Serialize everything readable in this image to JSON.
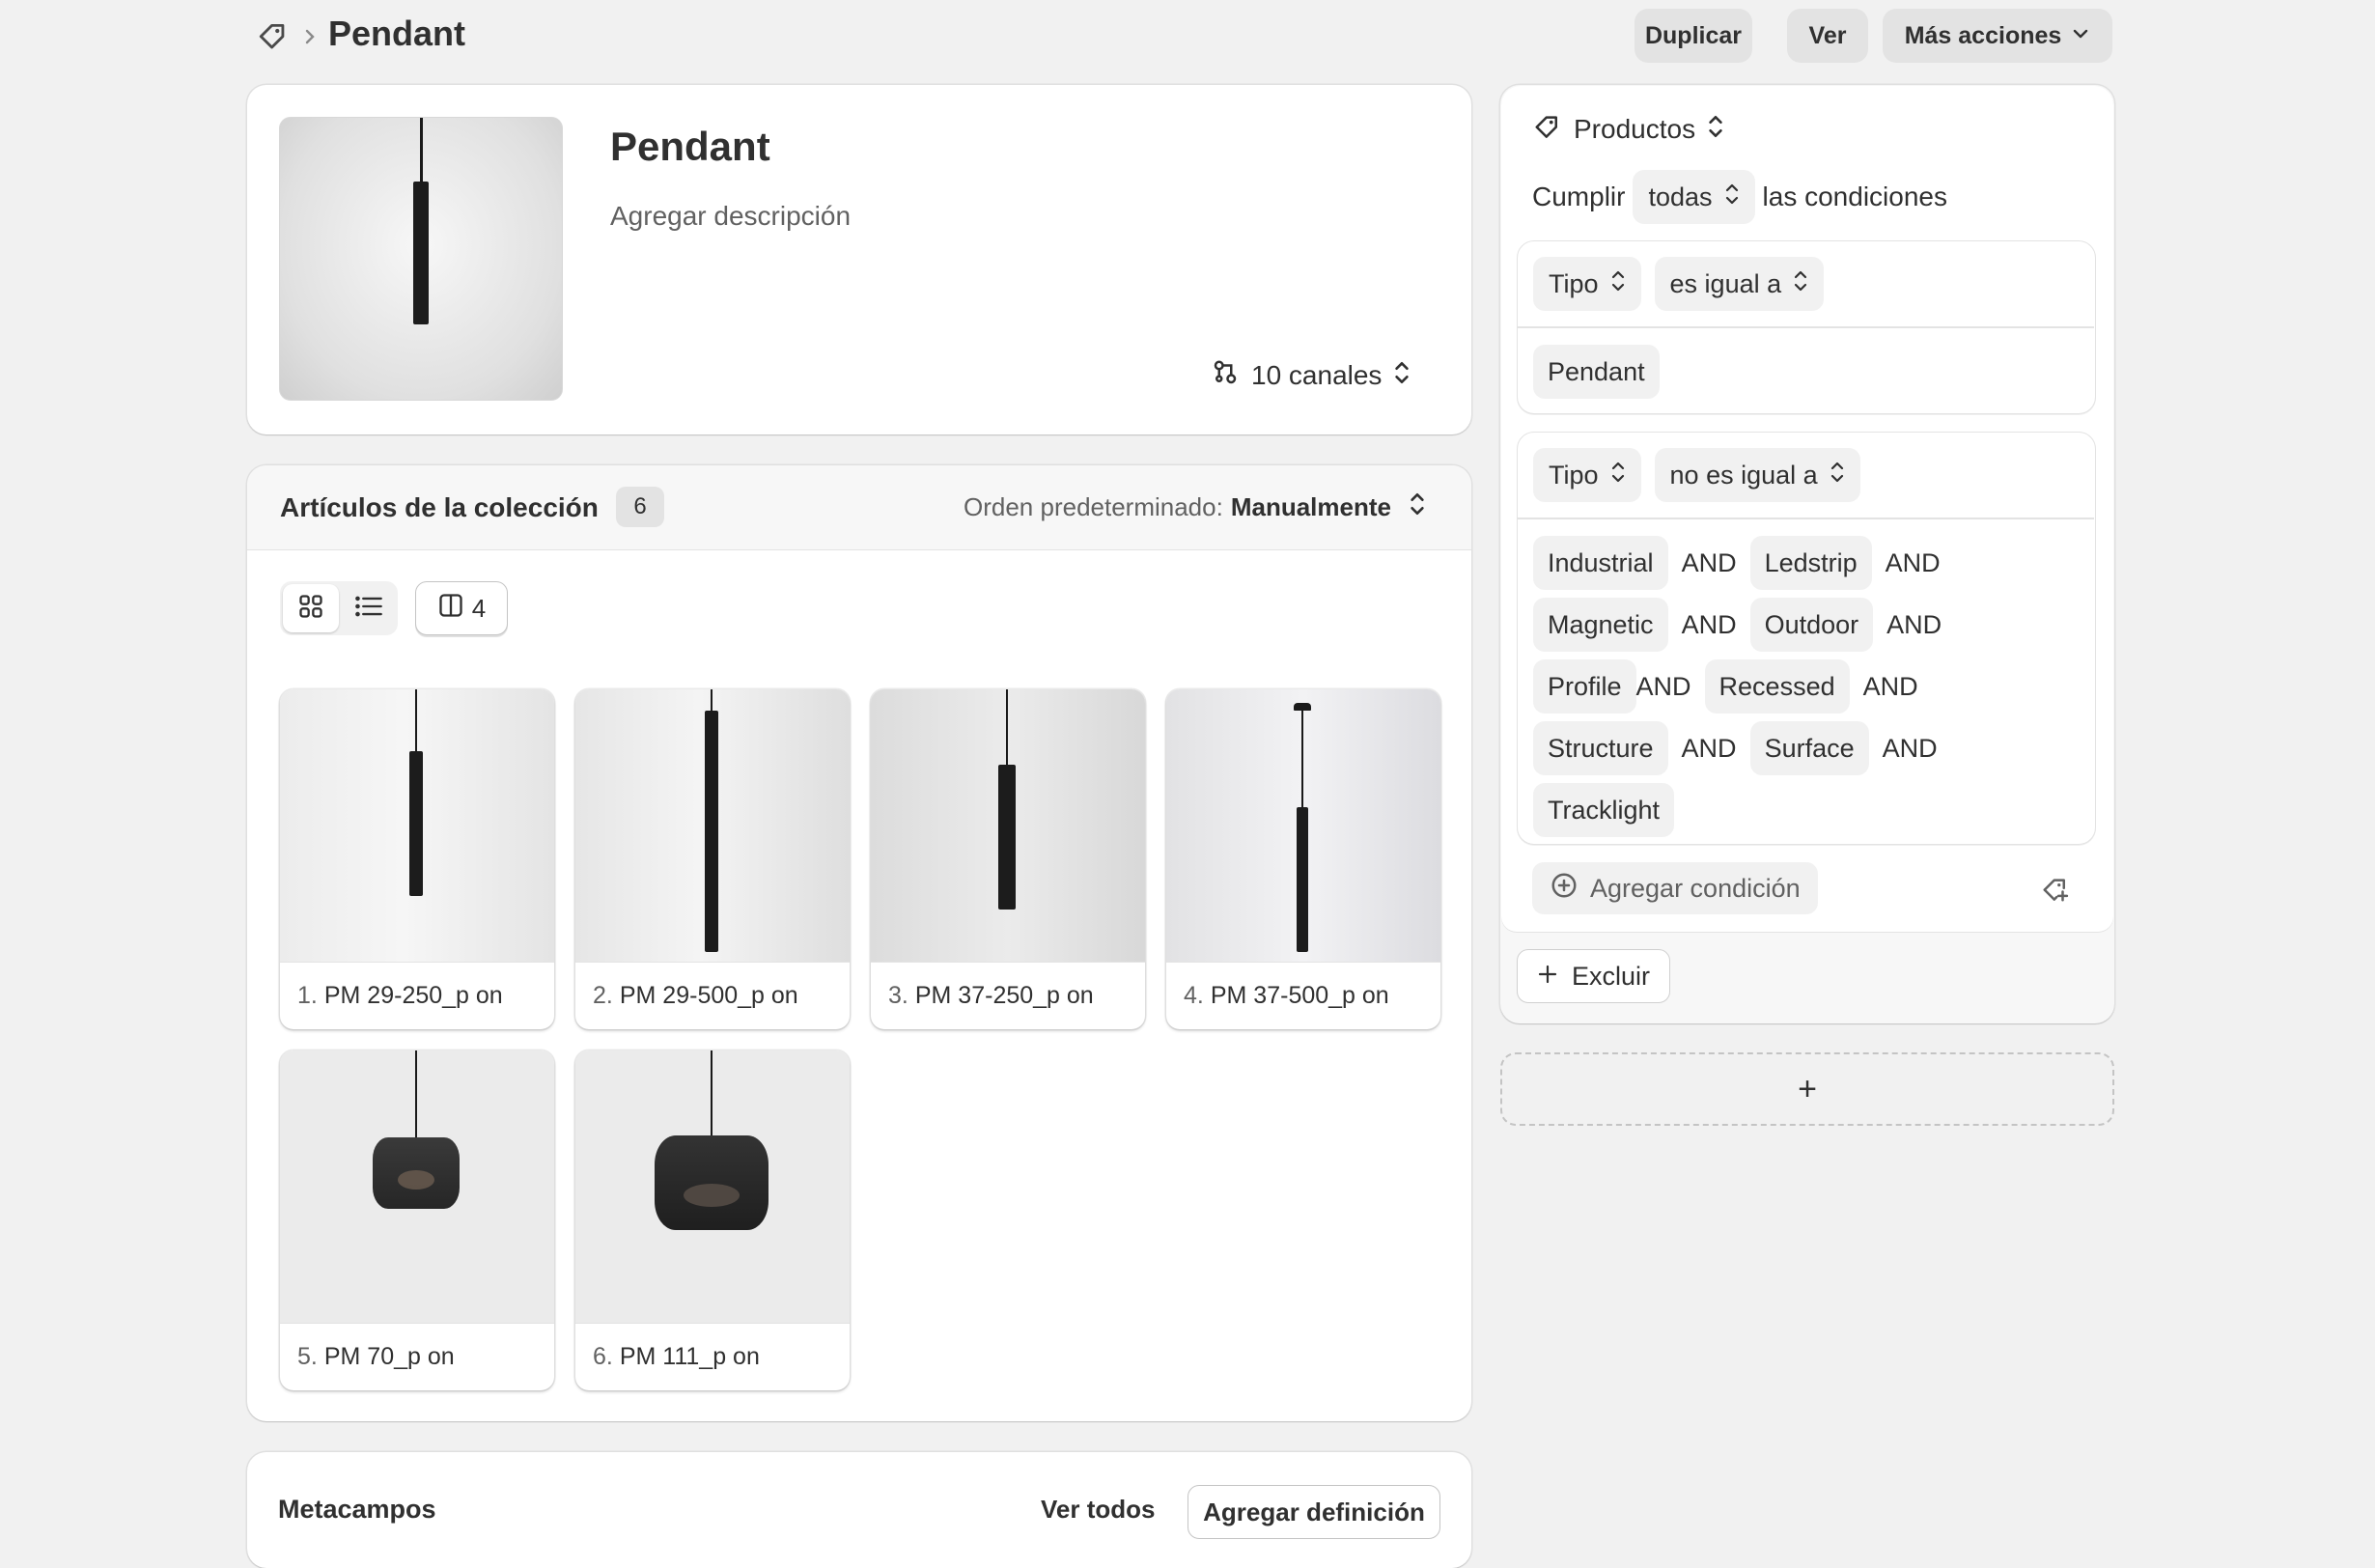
{
  "header": {
    "title": "Pendant",
    "actions": {
      "duplicate": "Duplicar",
      "view": "Ver",
      "more": "Más acciones"
    }
  },
  "collection": {
    "title": "Pendant",
    "description_placeholder": "Agregar descripción",
    "channels": "10 canales"
  },
  "items": {
    "title": "Artículos de la colección",
    "count": "6",
    "sort_label": "Orden predeterminado:",
    "sort_value": "Manualmente",
    "columns": "4",
    "products": [
      {
        "num": "1.",
        "name": "PM 29-250_p on"
      },
      {
        "num": "2.",
        "name": "PM 29-500_p on"
      },
      {
        "num": "3.",
        "name": "PM 37-250_p on"
      },
      {
        "num": "4.",
        "name": "PM 37-500_p on"
      },
      {
        "num": "5.",
        "name": "PM 70_p on"
      },
      {
        "num": "6.",
        "name": "PM 111_p on"
      }
    ]
  },
  "metafields": {
    "title": "Metacampos",
    "view_all": "Ver todos",
    "add_definition": "Agregar definición"
  },
  "conditions": {
    "scope": "Productos",
    "match_prefix": "Cumplir",
    "match_value": "todas",
    "match_suffix": "las condiciones",
    "rule1": {
      "field": "Tipo",
      "operator": "es igual a",
      "value": "Pendant"
    },
    "rule2": {
      "field": "Tipo",
      "operator": "no es igual a",
      "values": [
        "Industrial",
        "Ledstrip",
        "Magnetic",
        "Outdoor",
        "Profile",
        "Recessed",
        "Structure",
        "Surface",
        "Tracklight"
      ],
      "joiner": "AND"
    },
    "add_condition": "Agregar condición",
    "exclude": "Excluir",
    "add_block": "+"
  },
  "colors": {
    "background": "#f1f1f1",
    "card": "#ffffff",
    "button": "#e3e3e3",
    "text": "#303030",
    "muted": "#616161"
  },
  "icons": [
    "tag-icon",
    "chevron-right-icon",
    "chevron-down-icon",
    "channels-icon",
    "select-arrows-icon",
    "grid-view-icon",
    "list-view-icon",
    "columns-icon",
    "plus-circle-icon",
    "tag-plus-icon",
    "plus-icon"
  ]
}
